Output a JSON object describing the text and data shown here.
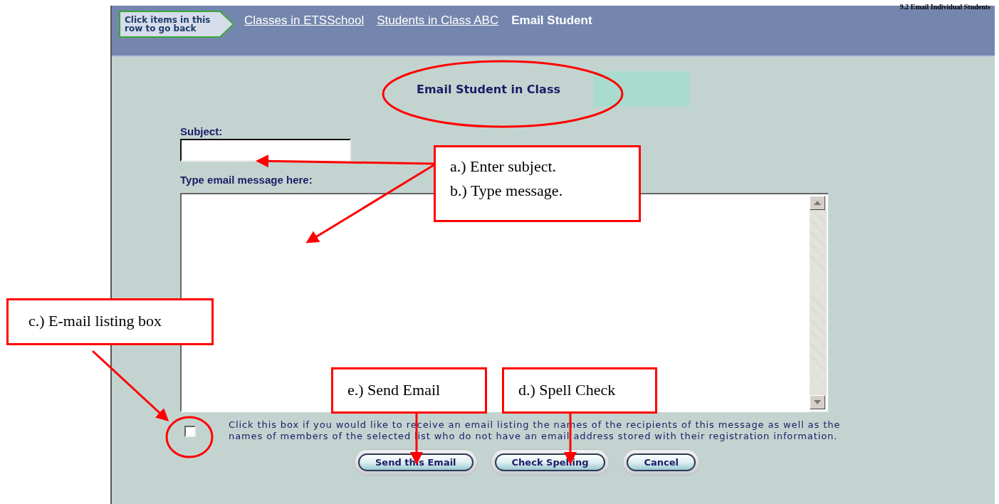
{
  "page_header": "9.2 Email Individual Students",
  "breadcrumb": {
    "hint": "Click items in this row to go back",
    "items": [
      {
        "label": "Classes in ETSSchool",
        "kind": "link"
      },
      {
        "label": "Students in Class ABC",
        "kind": "link"
      },
      {
        "label": "Email Student",
        "kind": "current"
      }
    ]
  },
  "title": "Email Student in Class",
  "subject": {
    "label": "Subject:"
  },
  "message": {
    "label": "Type email message here:"
  },
  "listing_option": {
    "checked": false,
    "text": "Click this box if you would like to receive an email listing the names of the recipients of this message as well as the names of members of the selected list who do not have an email address stored with their registration information."
  },
  "buttons": [
    "Send this Email",
    "Check Spelling",
    "Cancel"
  ],
  "callouts": [
    {
      "lines": [
        "a.) Enter subject.",
        "b.) Type message."
      ]
    },
    {
      "lines": [
        "c.) E-mail listing box"
      ]
    },
    {
      "lines": [
        "e.) Send Email"
      ]
    },
    {
      "lines": [
        "d.) Spell Check"
      ]
    }
  ]
}
